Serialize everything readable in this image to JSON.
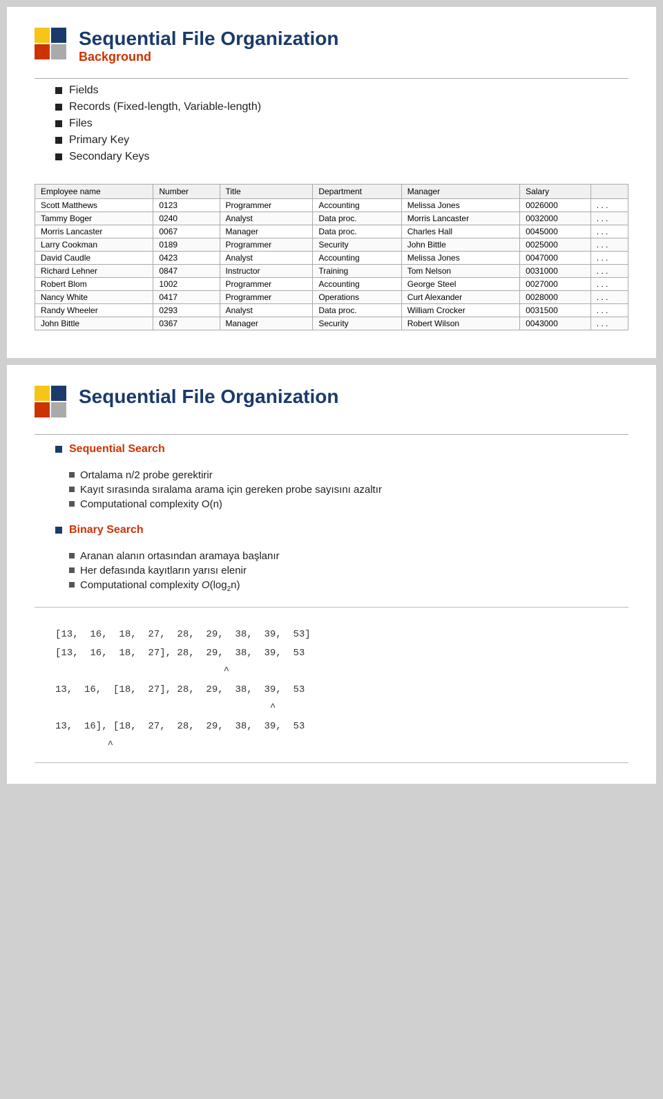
{
  "slide1": {
    "title": "Sequential File Organization",
    "subtitle": "Background",
    "bullets": [
      "Fields",
      "Records (Fixed-length, Variable-length)",
      "Files",
      "Primary Key",
      "Secondary Keys"
    ],
    "table": {
      "headers": [
        "Employee name",
        "Number",
        "Title",
        "Department",
        "Manager",
        "Salary",
        ""
      ],
      "rows": [
        [
          "Scott Matthews",
          "0123",
          "Programmer",
          "Accounting",
          "Melissa Jones",
          "0026000",
          ". . ."
        ],
        [
          "Tammy Boger",
          "0240",
          "Analyst",
          "Data proc.",
          "Morris Lancaster",
          "0032000",
          ". . ."
        ],
        [
          "Morris Lancaster",
          "0067",
          "Manager",
          "Data proc.",
          "Charles Hall",
          "0045000",
          ". . ."
        ],
        [
          "Larry Cookman",
          "0189",
          "Programmer",
          "Security",
          "John Bittle",
          "0025000",
          ". . ."
        ],
        [
          "David Caudle",
          "0423",
          "Analyst",
          "Accounting",
          "Melissa Jones",
          "0047000",
          ". . ."
        ],
        [
          "Richard Lehner",
          "0847",
          "Instructor",
          "Training",
          "Tom Nelson",
          "0031000",
          ". . ."
        ],
        [
          "Robert Blom",
          "1002",
          "Programmer",
          "Accounting",
          "George Steel",
          "0027000",
          ". . ."
        ],
        [
          "Nancy White",
          "0417",
          "Programmer",
          "Operations",
          "Curt Alexander",
          "0028000",
          ". . ."
        ],
        [
          "Randy Wheeler",
          "0293",
          "Analyst",
          "Data proc.",
          "William Crocker",
          "0031500",
          ". . ."
        ],
        [
          "John Bittle",
          "0367",
          "Manager",
          "Security",
          "Robert Wilson",
          "0043000",
          ". . ."
        ]
      ]
    }
  },
  "slide2": {
    "title": "Sequential File Organization",
    "section1": {
      "label": "Sequential Search",
      "bullets": [
        "Ortalama n/2 probe gerektirir",
        "Kayıt sırasında sıralama arama için gereken probe sayısını azaltır",
        "Computational complexity O(n)"
      ]
    },
    "section2": {
      "label": "Binary Search",
      "bullets": [
        "Aranan alanın ortasından aramaya başlanır",
        "Her defasında kayıtların yarısı elenir",
        "Computational complexity O(log₂n)"
      ]
    },
    "array_rows": [
      "[13,  16,  18,  27,  28,  29,  38,  39,  53]",
      "[13,  16,  18,  27],  28,  29,  38,  39,  53",
      "13,  16,  [18,  27],  28,  29,  38,  39,  53",
      "13,  16],  [18,  27,  28,  29,  38,  39,  53"
    ],
    "carets": [
      "",
      "         ^",
      "              ^",
      "    ^"
    ]
  }
}
